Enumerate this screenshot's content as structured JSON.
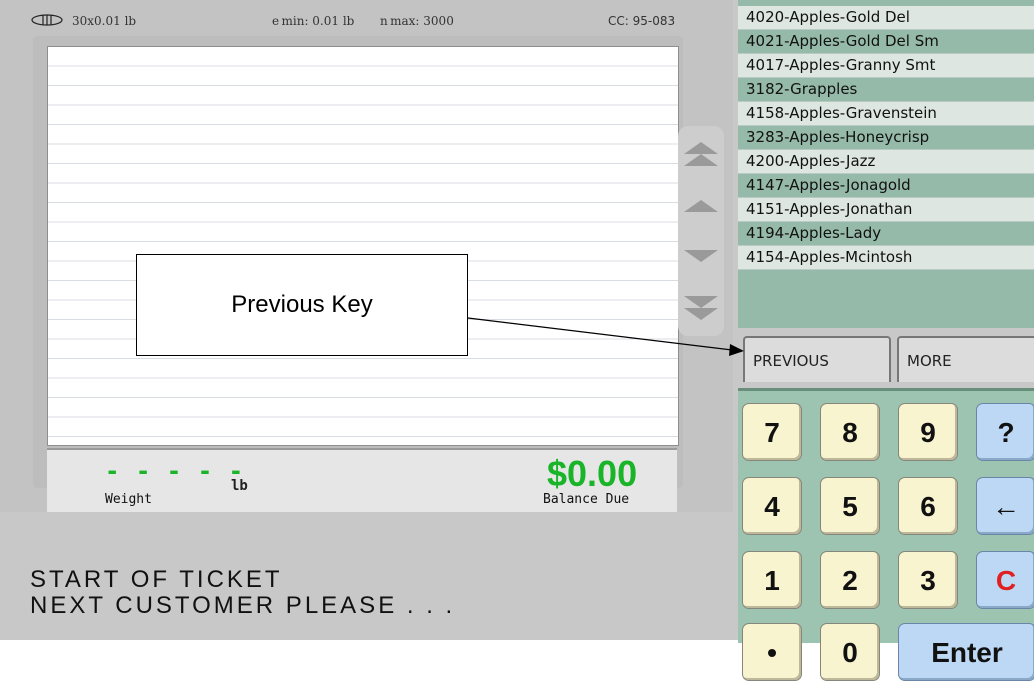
{
  "header": {
    "capacity": "30x0.01 lb",
    "e_min": "e min: 0.01 lb",
    "n_max": "n max: 3000",
    "cc": "CC: 95-083"
  },
  "totals": {
    "weight_value": "- - - - -",
    "weight_unit": "lb",
    "weight_label": "Weight",
    "balance_value": "$0.00",
    "balance_label": "Balance Due",
    "balance_color": "#19b428"
  },
  "messages": {
    "line1": "START OF TICKET",
    "line2": "NEXT CUSTOMER PLEASE . . ."
  },
  "products": [
    "4020-Apples-Gold Del",
    "4021-Apples-Gold Del Sm",
    "4017-Apples-Granny Smt",
    "3182-Grapples",
    "4158-Apples-Gravenstein",
    "3283-Apples-Honeycrisp",
    "4200-Apples-Jazz",
    "4147-Apples-Jonagold",
    "4151-Apples-Jonathan",
    "4194-Apples-Lady",
    "4154-Apples-Mcintosh"
  ],
  "tabs": {
    "previous": "PREVIOUS",
    "more": "MORE"
  },
  "keypad": {
    "k7": "7",
    "k8": "8",
    "k9": "9",
    "help": "?",
    "k4": "4",
    "k5": "5",
    "k6": "6",
    "back": "←",
    "k1": "1",
    "k2": "2",
    "k3": "3",
    "clear": "C",
    "dot": "•",
    "k0": "0",
    "enter": "Enter",
    "clear_color": "#e02020"
  },
  "callout": {
    "text": "Previous Key"
  },
  "scroll_icons": [
    "page-up-icon",
    "up-icon",
    "down-icon",
    "page-down-icon"
  ]
}
